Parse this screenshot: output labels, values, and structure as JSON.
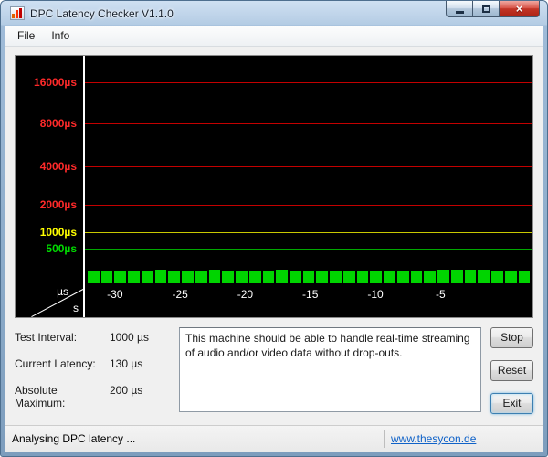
{
  "window": {
    "title": "DPC Latency Checker V1.1.0",
    "controls": {
      "close_glyph": "×"
    }
  },
  "menu": {
    "items": [
      {
        "label": "File"
      },
      {
        "label": "Info"
      }
    ]
  },
  "chart_data": {
    "type": "bar",
    "unit_y": "µs",
    "unit_x": "s",
    "bar_color": "#00d400",
    "grid": "horizontal-lines",
    "legend": "none",
    "gridlines": [
      {
        "label": "16000µs",
        "value": 16000,
        "label_color": "#ff2a2a",
        "line_color": "#c40000",
        "top_pct": 11.5
      },
      {
        "label": "8000µs",
        "value": 8000,
        "label_color": "#ff2a2a",
        "line_color": "#c40000",
        "top_pct": 29.9
      },
      {
        "label": "4000µs",
        "value": 4000,
        "label_color": "#ff2a2a",
        "line_color": "#c40000",
        "top_pct": 48.4
      },
      {
        "label": "2000µs",
        "value": 2000,
        "label_color": "#ff2a2a",
        "line_color": "#c40000",
        "top_pct": 65.6
      },
      {
        "label": "1000µs",
        "value": 1000,
        "label_color": "#ffff00",
        "line_color": "#c8c800",
        "top_pct": 77.5
      },
      {
        "label": "500µs",
        "value": 500,
        "label_color": "#00dd00",
        "line_color": "#00a800",
        "top_pct": 84.8
      }
    ],
    "x_ticks": [
      {
        "label": "-30",
        "seconds": -30
      },
      {
        "label": "-25",
        "seconds": -25
      },
      {
        "label": "-20",
        "seconds": -20
      },
      {
        "label": "-15",
        "seconds": -15
      },
      {
        "label": "-10",
        "seconds": -10
      },
      {
        "label": "-5",
        "seconds": -5
      }
    ],
    "bar_values_us": [
      180,
      172,
      186,
      176,
      190,
      196,
      182,
      172,
      186,
      192,
      176,
      182,
      172,
      186,
      196,
      182,
      176,
      190,
      182,
      172,
      186,
      176,
      190,
      182,
      176,
      188,
      196,
      200,
      192,
      200,
      186,
      176,
      172
    ]
  },
  "stats": [
    {
      "label": "Test Interval:",
      "value": "1000 µs"
    },
    {
      "label": "Current Latency:",
      "value": "130 µs"
    },
    {
      "label": "Absolute Maximum:",
      "value": "200 µs"
    }
  ],
  "message": "This machine should be able to handle real-time streaming of audio and/or video data without drop-outs.",
  "buttons": [
    {
      "label": "Stop"
    },
    {
      "label": "Reset"
    },
    {
      "label": "Exit"
    }
  ],
  "statusbar": {
    "status": "Analysing DPC latency ...",
    "link": "www.thesycon.de"
  },
  "colors": {
    "chart_background": "#000000",
    "dialog_background": "#f0f0f0",
    "titlebar_tint": "#a9c4e0",
    "close_button_red": "#c23527",
    "link_blue": "#0f62c8"
  }
}
